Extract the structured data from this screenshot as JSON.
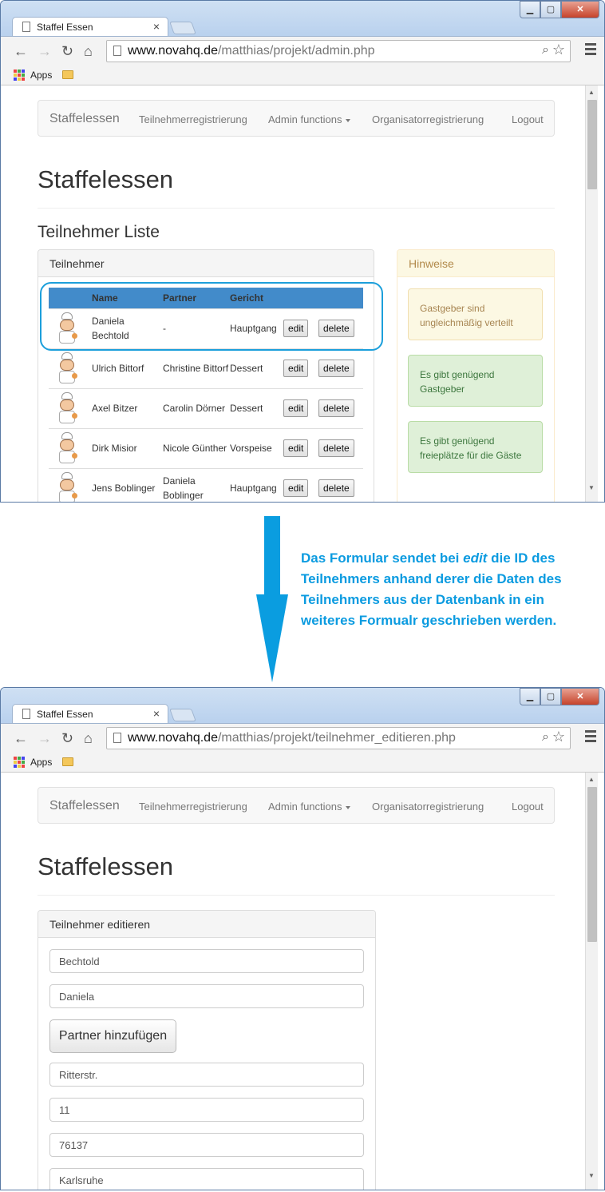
{
  "window1": {
    "tab_title": "Staffel Essen",
    "url_host": "www.novahq.de",
    "url_path": "/matthias/projekt/admin.php",
    "bookmarks_apps": "Apps"
  },
  "window2": {
    "tab_title": "Staffel Essen",
    "url_host": "www.novahq.de",
    "url_path": "/matthias/projekt/teilnehmer_editieren.php",
    "bookmarks_apps": "Apps"
  },
  "navbar": {
    "brand": "Staffelessen",
    "items": [
      "Teilnehmerregistrierung",
      "Admin functions",
      "Organisatorregistrierung",
      "Logout"
    ]
  },
  "page1": {
    "title": "Staffelessen",
    "subtitle": "Teilnehmer Liste",
    "panel_heading": "Teilnehmer",
    "columns": [
      "Name",
      "Partner",
      "Gericht"
    ],
    "rows": [
      {
        "name": "Daniela Bechtold",
        "partner": "-",
        "gericht": "Hauptgang"
      },
      {
        "name": "Ulrich Bittorf",
        "partner": "Christine Bittorf",
        "gericht": "Dessert"
      },
      {
        "name": "Axel Bitzer",
        "partner": "Carolin Dörner",
        "gericht": "Dessert"
      },
      {
        "name": "Dirk Misior",
        "partner": "Nicole Günther",
        "gericht": "Vorspeise"
      },
      {
        "name": "Jens Boblinger",
        "partner": "Daniela Boblinger",
        "gericht": "Hauptgang"
      }
    ],
    "edit_label": "edit",
    "delete_label": "delete",
    "hints_heading": "Hinweise",
    "hints": [
      {
        "text": "Gastgeber sind ungleichmäßig verteilt",
        "kind": "warning"
      },
      {
        "text": "Es gibt genügend Gastgeber",
        "kind": "success"
      },
      {
        "text": "Es gibt genügend freieplätze für die Gäste",
        "kind": "success"
      }
    ]
  },
  "annotation": {
    "line1_pre": "Das Formular sendet bei ",
    "line1_em": "edit",
    "line1_post": " die",
    "rest": "ID des Teilnehmers anhand derer die Daten des Teilnehmers aus der Datenbank in ein weiteres Formualr geschrieben werden."
  },
  "page2": {
    "title": "Staffelessen",
    "panel_heading": "Teilnehmer editieren",
    "fields": [
      "Bechtold",
      "Daniela"
    ],
    "partner_button": "Partner hinzufügen",
    "address_fields": [
      "Ritterstr.",
      "11",
      "76137",
      "Karlsruhe"
    ]
  },
  "colors": {
    "accent": "#428bca",
    "annotation": "#0b9be0"
  }
}
